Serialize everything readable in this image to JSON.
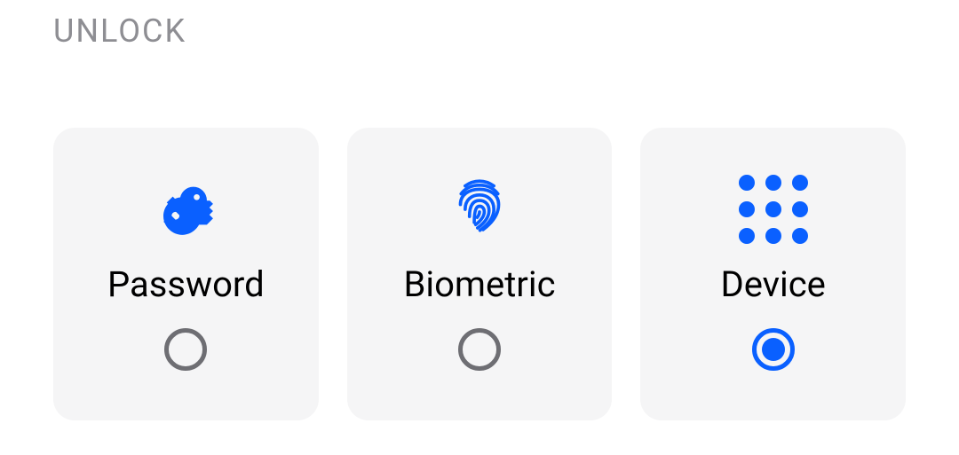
{
  "section": {
    "title": "UNLOCK"
  },
  "options": [
    {
      "label": "Password",
      "selected": false
    },
    {
      "label": "Biometric",
      "selected": false
    },
    {
      "label": "Device",
      "selected": true
    }
  ],
  "colors": {
    "accent": "#0a60ff",
    "muted": "#8e8e93",
    "card": "#f5f5f6"
  }
}
